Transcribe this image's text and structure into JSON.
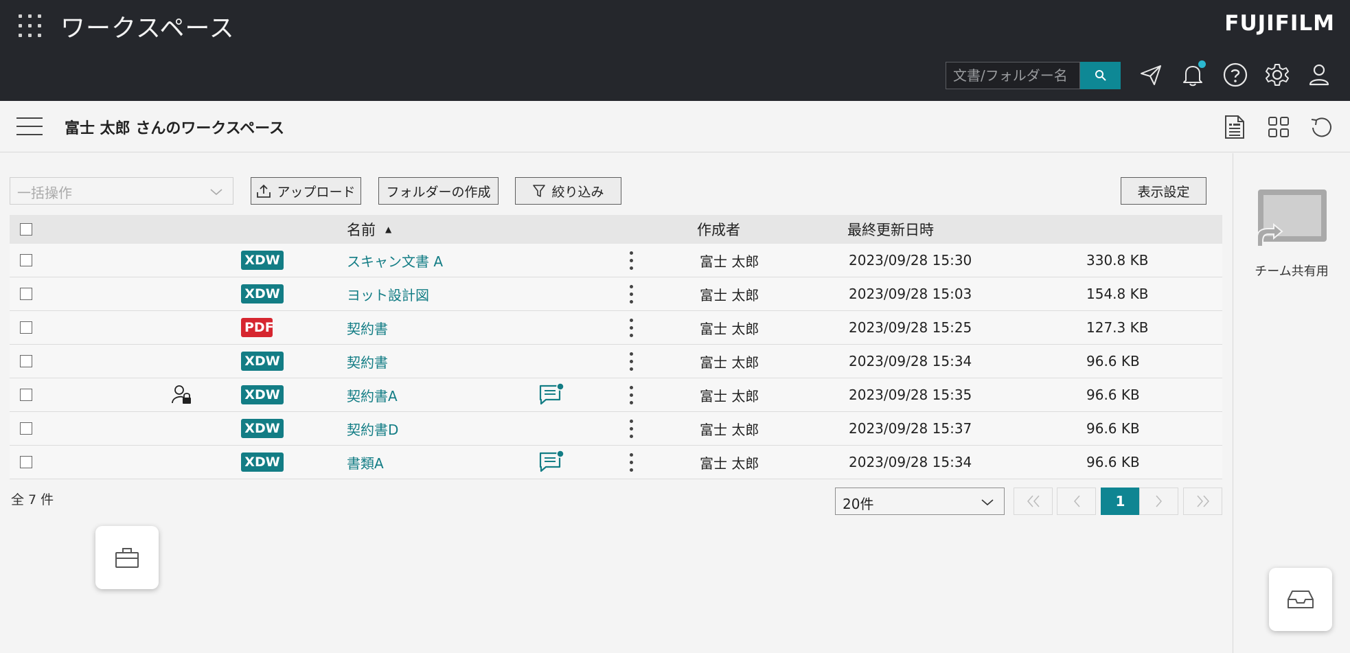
{
  "header": {
    "app_title": "ワークスペース",
    "brand": "FUJIFILM",
    "search_placeholder": "文書/フォルダー名",
    "accent_color": "#0e8895"
  },
  "subheader": {
    "workspace_title": "富士 太郎 さんのワークスペース"
  },
  "toolbar": {
    "bulk_placeholder": "一括操作",
    "upload_label": "アップロード",
    "create_folder_label": "フォルダーの作成",
    "filter_label": "絞り込み",
    "display_settings_label": "表示設定"
  },
  "table": {
    "columns": {
      "name": "名前",
      "name_sort": "▲",
      "creator": "作成者",
      "updated": "最終更新日時"
    },
    "rows": [
      {
        "type": "XDW",
        "name": "スキャン文書 A",
        "creator": "富士 太郎",
        "updated": "2023/09/28 15:30",
        "size": "330.8 KB",
        "locked": false,
        "comment": false
      },
      {
        "type": "XDW",
        "name": "ヨット設計図",
        "creator": "富士 太郎",
        "updated": "2023/09/28 15:03",
        "size": "154.8 KB",
        "locked": false,
        "comment": false
      },
      {
        "type": "PDF",
        "name": "契約書",
        "creator": "富士 太郎",
        "updated": "2023/09/28 15:25",
        "size": "127.3 KB",
        "locked": false,
        "comment": false
      },
      {
        "type": "XDW",
        "name": "契約書",
        "creator": "富士 太郎",
        "updated": "2023/09/28 15:34",
        "size": "96.6 KB",
        "locked": false,
        "comment": false
      },
      {
        "type": "XDW",
        "name": "契約書A",
        "creator": "富士 太郎",
        "updated": "2023/09/28 15:35",
        "size": "96.6 KB",
        "locked": true,
        "comment": true
      },
      {
        "type": "XDW",
        "name": "契約書D",
        "creator": "富士 太郎",
        "updated": "2023/09/28 15:37",
        "size": "96.6 KB",
        "locked": false,
        "comment": false
      },
      {
        "type": "XDW",
        "name": "書類A",
        "creator": "富士 太郎",
        "updated": "2023/09/28 15:34",
        "size": "96.6 KB",
        "locked": false,
        "comment": true
      }
    ]
  },
  "footer": {
    "total_label": "全 7 件",
    "per_page": "20件",
    "current_page": "1"
  },
  "right_panel": {
    "team_label": "チーム共有用"
  }
}
